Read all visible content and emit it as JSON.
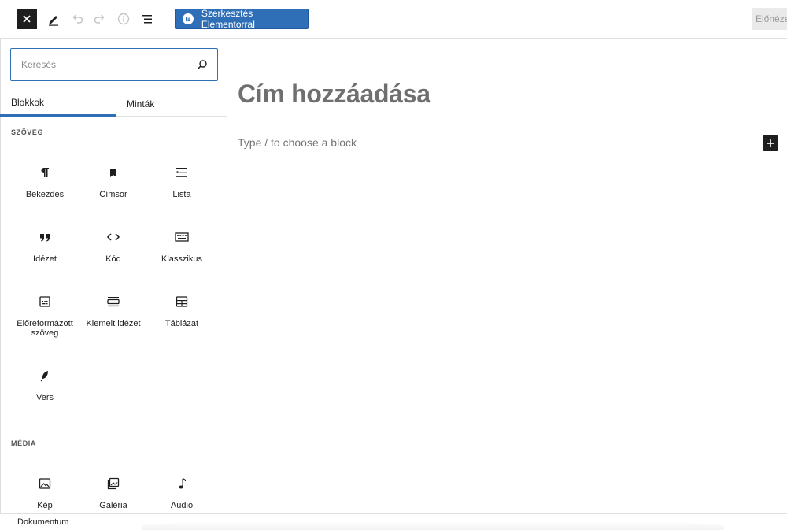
{
  "toolbar": {
    "close_icon": "close-icon",
    "edit_icon": "pencil-icon",
    "undo_icon": "undo-icon",
    "redo_icon": "redo-icon",
    "info_icon": "info-icon",
    "list_view_icon": "list-view-icon",
    "elementor_label": "Szerkesztés Elementorral",
    "preview_label": "Előnézet"
  },
  "inserter": {
    "search_placeholder": "Keresés",
    "tabs": [
      {
        "label": "Blokkok",
        "active": true
      },
      {
        "label": "Minták",
        "active": false
      }
    ],
    "categories": [
      {
        "title": "SZÖVEG",
        "blocks": [
          {
            "label": "Bekezdés",
            "icon": "paragraph-icon"
          },
          {
            "label": "Címsor",
            "icon": "heading-icon"
          },
          {
            "label": "Lista",
            "icon": "list-icon"
          },
          {
            "label": "Idézet",
            "icon": "quote-icon"
          },
          {
            "label": "Kód",
            "icon": "code-icon"
          },
          {
            "label": "Klasszikus",
            "icon": "keyboard-icon"
          },
          {
            "label": "Előreformázott szöveg",
            "icon": "preformatted-icon"
          },
          {
            "label": "Kiemelt idézet",
            "icon": "pullquote-icon"
          },
          {
            "label": "Táblázat",
            "icon": "table-icon"
          },
          {
            "label": "Vers",
            "icon": "verse-icon"
          }
        ]
      },
      {
        "title": "MÉDIA",
        "blocks": [
          {
            "label": "Kép",
            "icon": "image-icon"
          },
          {
            "label": "Galéria",
            "icon": "gallery-icon"
          },
          {
            "label": "Audió",
            "icon": "audio-icon"
          }
        ]
      }
    ]
  },
  "editor": {
    "title_placeholder": "Cím hozzáadása",
    "block_placeholder": "Type / to choose a block",
    "add_block_icon": "plus-icon"
  },
  "footer": {
    "breadcrumb": "Dokumentum"
  },
  "colors": {
    "accent": "#2f6fb8",
    "dark": "#1e1e1e"
  }
}
